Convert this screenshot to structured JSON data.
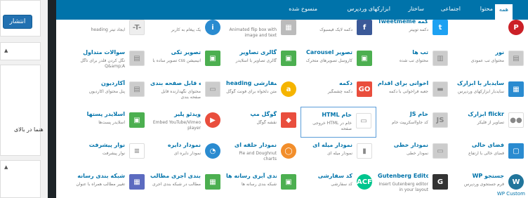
{
  "sidebar": {
    "publish_label": "انتشار",
    "helper_text": "هنما در بالای"
  },
  "tabs": [
    {
      "label": "همه",
      "active": true
    },
    {
      "label": "محتوا"
    },
    {
      "label": "اجتماعی"
    },
    {
      "label": "ساختار"
    },
    {
      "label": "ابزارکهای وردپرس"
    },
    {
      "label": "منسوخ شده"
    }
  ],
  "elements": [
    {
      "title": "",
      "desc": "",
      "icon": "pinterest-icon",
      "color": "#cb2027",
      "shape": "round",
      "glyph": "P"
    },
    {
      "title": "Tweetmeme دکمه",
      "desc": "دکمه توییتر",
      "icon": "twitter-icon",
      "color": "#1da1f2",
      "glyph": "t"
    },
    {
      "title": "",
      "desc": "دکمه لایک فیسبوک",
      "icon": "facebook-icon",
      "color": "#3b5998",
      "glyph": "f"
    },
    {
      "title": "",
      "desc": "Animated flip box with image and text",
      "icon": "flip-box-icon",
      "color": "#bbb",
      "glyph": "▦"
    },
    {
      "title": "",
      "desc": "یک پیغام به کاربر",
      "icon": "info-icon",
      "color": "#2a8bd0",
      "shape": "round",
      "glyph": "i"
    },
    {
      "title": "",
      "desc": "heading ایجاد تیتر",
      "icon": "heading-icon",
      "color": "#eee",
      "glyph": "-T-"
    },
    {
      "title": "نور",
      "desc": "محتوای تب عمودی",
      "icon": "vertical-tabs-icon",
      "color": "#ccc",
      "glyph": "▤"
    },
    {
      "title": "تب ها",
      "desc": "محتوای تب شده",
      "icon": "tabs-icon",
      "color": "#ccc",
      "glyph": "▥"
    },
    {
      "title": "Carousel تصویر",
      "desc": "کاروسل تصویرهای متحرک",
      "icon": "image-carousel-icon",
      "color": "#4caf50",
      "glyph": "▣"
    },
    {
      "title": "گالری تصاویر",
      "desc": "گالری تصاویر با اسلایدر",
      "icon": "image-gallery-icon",
      "color": "#4caf50",
      "glyph": "▣"
    },
    {
      "title": "تصویر تکی",
      "desc": "تصویر ساده با css انیمیشن",
      "icon": "single-image-icon",
      "color": "#4caf50",
      "glyph": "▣"
    },
    {
      "title": "سوالات متداول",
      "desc": "تگل کردن فلدر برای تاگل Q&amp;A",
      "icon": "faq-icon",
      "color": "#ccc",
      "glyph": "▤"
    },
    {
      "title": "سایدبار با ابزارک",
      "desc": "سایدبار ابزارکهای وردپرس",
      "icon": "widget-sidebar-icon",
      "color": "#2a8bd0",
      "glyph": "▦"
    },
    {
      "title": "فراخوانی برای اقدام",
      "desc": "جعبه فراخوانی با دکمه",
      "icon": "call-to-action-icon",
      "color": "#ccc",
      "glyph": "▬"
    },
    {
      "title": "دکمه",
      "desc": "دکمه چشمگیر",
      "icon": "button-icon",
      "color": "#e94e3d",
      "glyph": "GO"
    },
    {
      "title": "heading سفارشی",
      "desc": "متن دلخواه برای فونت گوگل",
      "icon": "custom-heading-icon",
      "color": "#f5b400",
      "shape": "round",
      "glyph": "a"
    },
    {
      "title": "نگهدارنده قابل صفحه بندی",
      "desc": "محتوای نگهدارنده قابل صفحه بندی",
      "icon": "pageable-container-icon",
      "color": "#ccc",
      "glyph": "▭"
    },
    {
      "title": "آکاردیون",
      "desc": "پنل محتوای آکاردیون",
      "icon": "accordion-icon",
      "color": "#ccc",
      "glyph": "▤"
    },
    {
      "title": "ابزارک flickr",
      "desc": "تصاویر از فلیکر",
      "icon": "flickr-icon",
      "color": "#fff",
      "glyph": "●●"
    },
    {
      "title": "JS خام",
      "desc": "کد جاوااسکریپت خام",
      "icon": "raw-js-icon",
      "color": "#ccc",
      "glyph": "JS"
    },
    {
      "title": "HTML خام",
      "desc": "خروجی HTML خام در صفحه",
      "icon": "raw-html-icon",
      "color": "#fff",
      "glyph": "▭",
      "selected": true
    },
    {
      "title": "گوگل مپ",
      "desc": "نقشه گوگل",
      "icon": "google-map-icon",
      "color": "#e94e3d",
      "glyph": "◆"
    },
    {
      "title": "ویدئو پلیر",
      "desc": "Embed YouTube/Vimeo player",
      "icon": "video-player-icon",
      "color": "#e94e3d",
      "shape": "round",
      "glyph": "▶"
    },
    {
      "title": "اسلایدر پستها",
      "desc": "اسلایدر پست‌ها",
      "icon": "posts-slider-icon",
      "color": "#4caf50",
      "glyph": "▣"
    },
    {
      "title": "فضای خالی",
      "desc": "فضای خالی با ارتفاع",
      "icon": "empty-space-icon",
      "color": "#2a8bd0",
      "glyph": "▢"
    },
    {
      "title": "نمودار خطی",
      "desc": "نمودار خطی",
      "icon": "line-chart-icon",
      "color": "#ccc",
      "glyph": "▭"
    },
    {
      "title": "نمودار میله ای",
      "desc": "نمودار میله ای",
      "icon": "bar-chart-icon",
      "color": "#fff",
      "glyph": "▮"
    },
    {
      "title": "نمودار حلقه ای",
      "desc": "Pie and Doughnut charts",
      "icon": "round-chart-icon",
      "color": "#f28e2b",
      "shape": "round",
      "glyph": "◯"
    },
    {
      "title": "نمودار دایره",
      "desc": "نمودار دایره ای",
      "icon": "pie-chart-icon",
      "color": "#2a8bd0",
      "shape": "round",
      "glyph": "◔"
    },
    {
      "title": "نوار پیشرفت",
      "desc": "نوار پیشرفت",
      "icon": "progress-bar-icon",
      "color": "#fff",
      "glyph": "≡"
    },
    {
      "title": "WP جستجو",
      "desc": "فرم جستجوی وردپرس",
      "icon": "wordpress-icon",
      "color": "#21759b",
      "shape": "round",
      "glyph": "W"
    },
    {
      "title": "Gutenberg Editor",
      "desc": "Insert Gutenberg editor in your layout",
      "icon": "gutenberg-icon",
      "color": "#333",
      "glyph": "G"
    },
    {
      "title": "کد سفارشی",
      "desc": "کد سفارشی",
      "icon": "acf-icon",
      "color": "#00c58e",
      "shape": "round",
      "glyph": "ACF"
    },
    {
      "title": "شبکه بندی آبری رسانه ها",
      "desc": "شبکه بندی رسانه ها",
      "icon": "media-masonry-grid-icon",
      "color": "#4caf50",
      "glyph": "▣"
    },
    {
      "title": "شبکه بندی آجری مطالب",
      "desc": "مطالب در شبکه بندی آجری",
      "icon": "masonry-grid-icon",
      "color": "#4caf50",
      "glyph": "▦"
    },
    {
      "title": "شبکه بندی رسانه",
      "desc": "تغییر مطالب همراه با عنوان",
      "icon": "media-grid-icon",
      "color": "#5c6bc0",
      "glyph": "▦"
    }
  ],
  "more_label": "WP Custom"
}
